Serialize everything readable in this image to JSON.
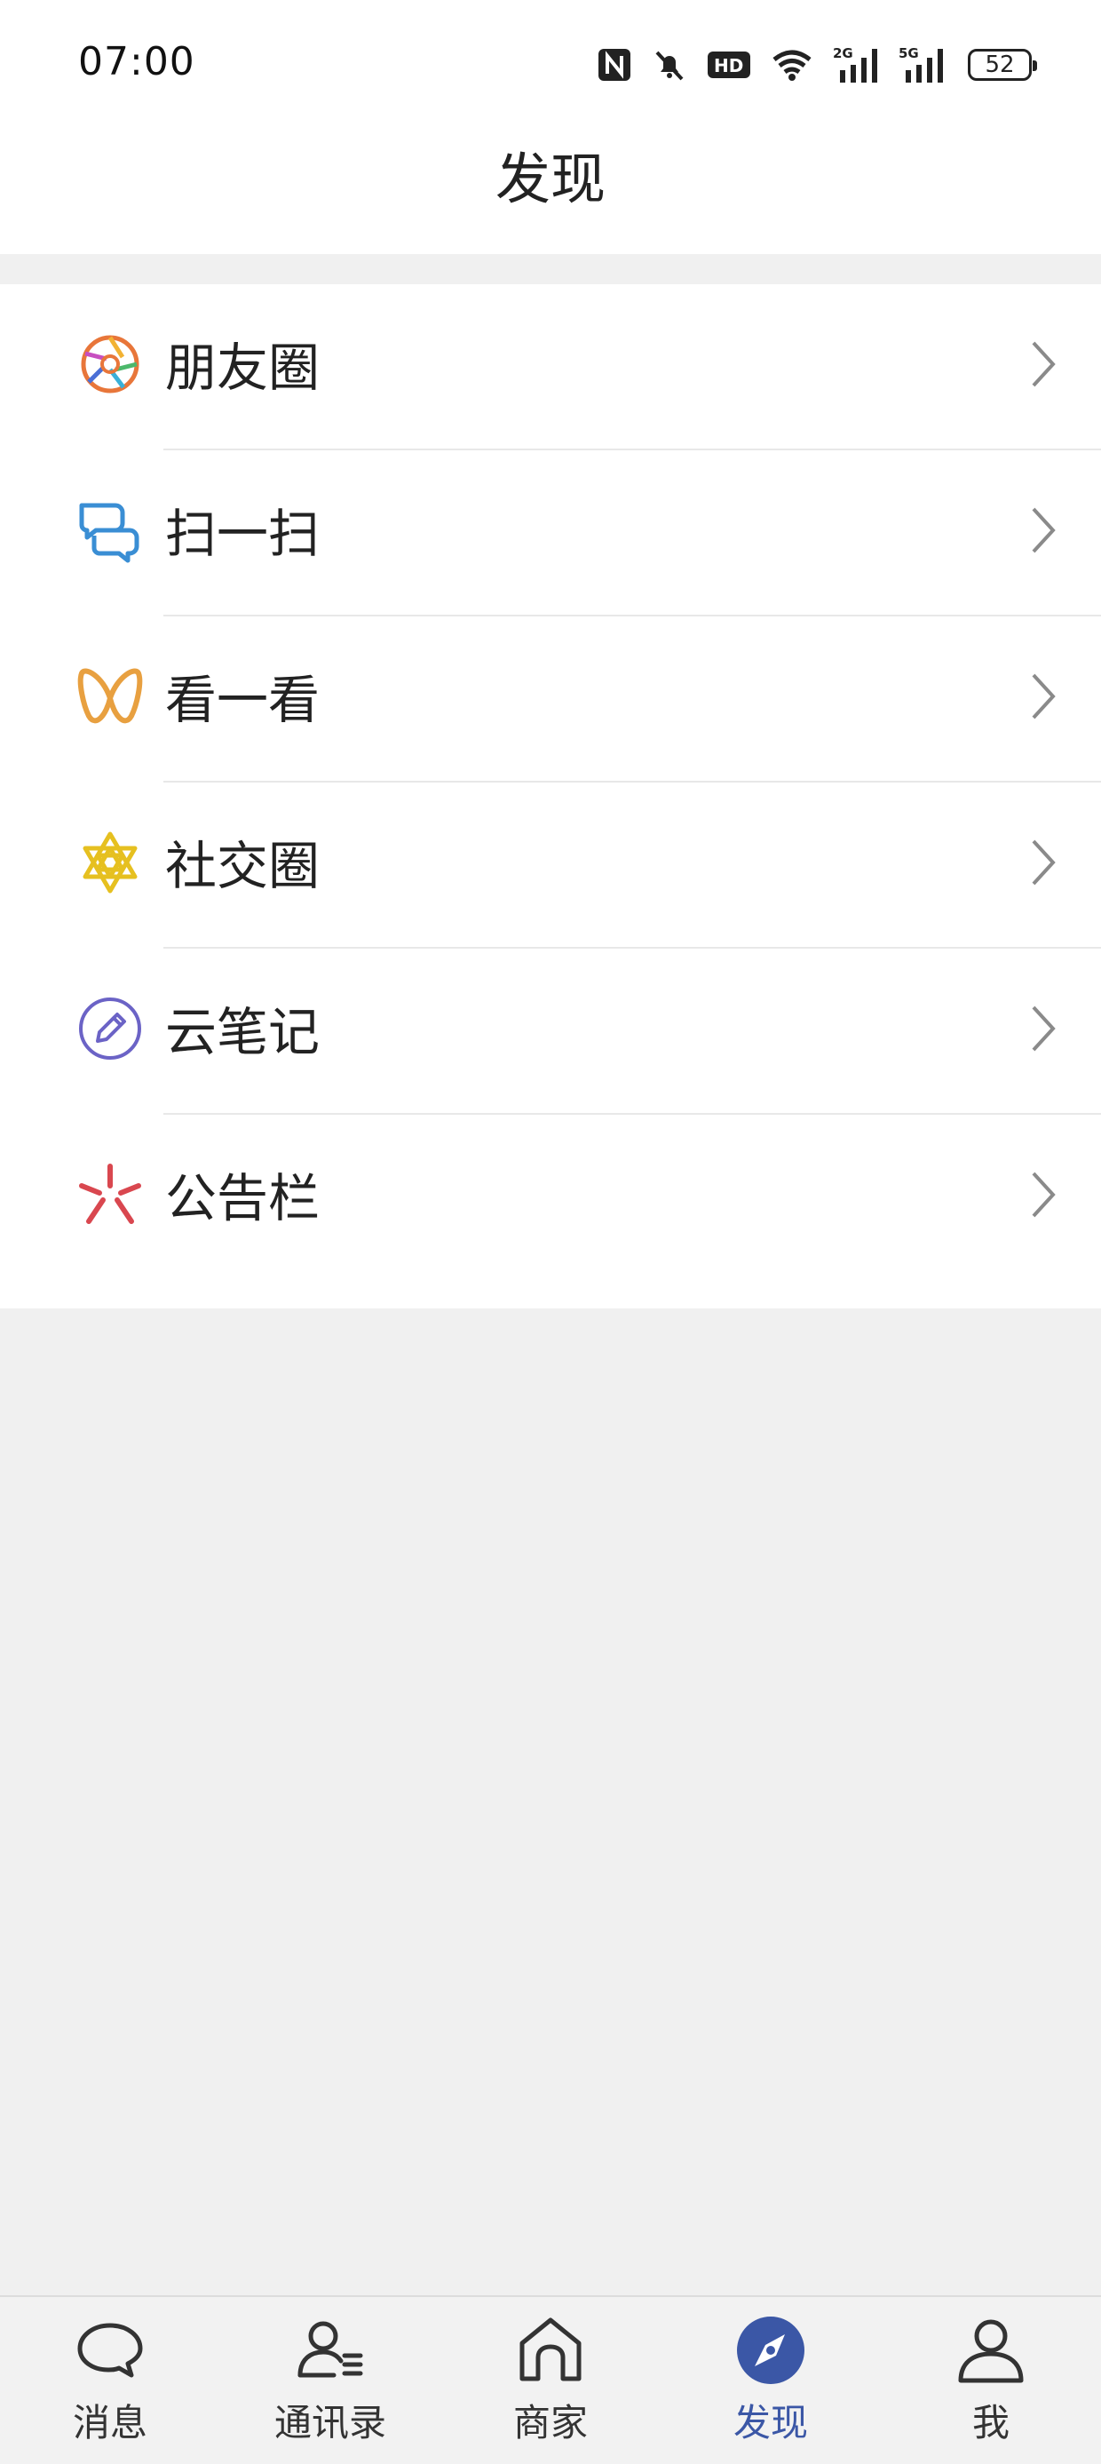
{
  "status_bar": {
    "time": "07:00",
    "icons": [
      "nfc-icon",
      "mute-icon",
      "hd-icon",
      "wifi-icon",
      "signal-2g-icon",
      "signal-5g-icon"
    ],
    "battery": "52"
  },
  "header": {
    "title": "发现"
  },
  "menu": {
    "items": [
      {
        "label": "朋友圈",
        "icon": "aperture-icon",
        "color": "#e8763a"
      },
      {
        "label": "扫一扫",
        "icon": "scan-chat-icon",
        "color": "#3a8ed4"
      },
      {
        "label": "看一看",
        "icon": "butterfly-icon",
        "color": "#e8a040"
      },
      {
        "label": "社交圈",
        "icon": "star-ring-icon",
        "color": "#e6c020"
      },
      {
        "label": "云笔记",
        "icon": "pencil-circle-icon",
        "color": "#6b63c6"
      },
      {
        "label": "公告栏",
        "icon": "sparkle-icon",
        "color": "#d9474f"
      }
    ]
  },
  "tabbar": {
    "active_color": "#3b57a6",
    "tabs": [
      {
        "label": "消息",
        "icon": "chat-bubble-icon"
      },
      {
        "label": "通讯录",
        "icon": "contacts-icon"
      },
      {
        "label": "商家",
        "icon": "home-icon"
      },
      {
        "label": "发现",
        "icon": "compass-icon",
        "active": true
      },
      {
        "label": "我",
        "icon": "person-icon"
      }
    ]
  }
}
